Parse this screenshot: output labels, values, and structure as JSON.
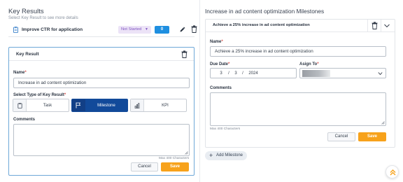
{
  "left": {
    "title": "Key Results",
    "subtitle": "Select Key Result to see more details",
    "key_result_row": {
      "name": "Improve CTR for application",
      "status": "Not Started",
      "count": "0"
    },
    "editor": {
      "header": "Key Result",
      "name_label": "Name",
      "name_value": "Increase in ad content optimization",
      "type_label": "Select Type of Key Result",
      "types": [
        {
          "label": "Task",
          "icon": "clipboard-icon",
          "active": false
        },
        {
          "label": "Milestone",
          "icon": "flag-icon",
          "active": true
        },
        {
          "label": "KPI",
          "icon": "bar-chart-icon",
          "active": false
        }
      ],
      "comments_label": "Comments",
      "comments_value": "",
      "max_hint": "Max 400 Characters",
      "cancel_label": "Cancel",
      "save_label": "Save"
    }
  },
  "right": {
    "title": "Increase in ad content optimization Milestones",
    "milestone": {
      "header": "Achieve a 25% increase in ad content optimization",
      "name_label": "Name",
      "name_value": "Achieve a 25% increase in ad content optimization",
      "due_date_label": "Due Date",
      "due_date": {
        "month": "3",
        "day": "3",
        "year": "2024"
      },
      "assign_label": "Asign To",
      "comments_label": "Comments",
      "comments_value": "",
      "max_hint": "Max 400 Characters",
      "cancel_label": "Cancel",
      "save_label": "Save"
    },
    "add_milestone_label": "Add Milestone"
  },
  "colors": {
    "accent_blue": "#124a9a",
    "save_orange": "#f7a21b",
    "status_purple": "#8156c2",
    "badge_blue": "#1f8fe0",
    "required_red": "#d9534f"
  }
}
